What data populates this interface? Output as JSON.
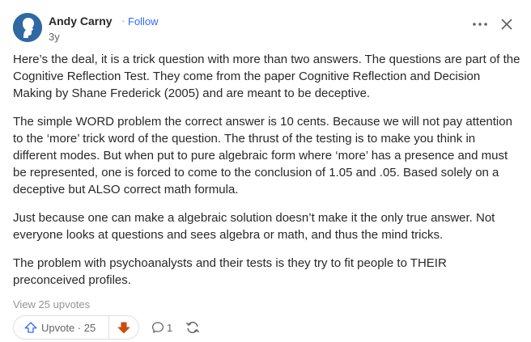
{
  "author": {
    "name": "Andy Carny",
    "separator": "·",
    "follow_label": "Follow",
    "timestamp": "3y"
  },
  "header": {
    "more_icon": "more-horizontal-icon",
    "close_icon": "close-icon"
  },
  "answer": {
    "paragraphs": [
      "Here’s the deal, it is a trick question with more than two answers. The questions are part of the Cognitive Reflection Test. They come from the paper Cognitive Reflection and Decision Making by Shane Frederick (2005) and are meant to be deceptive.",
      "The simple WORD problem the correct answer is 10 cents. Because we will not pay attention to the ‘more’ trick word of the question. The thrust of the testing is to make you think in different modes. But when put to pure algebraic form where ‘more’ has a presence and must be represented, one is forced to come to the conclusion of 1.05 and .05. Based solely on a deceptive but ALSO correct math formula.",
      "Just because one can make a algebraic solution doesn’t make it the only true answer. Not everyone looks at questions and sees algebra or math, and thus the mind tricks.",
      "The problem with psychoanalysts and their tests is they try to fit people to THEIR preconceived profiles."
    ]
  },
  "footer": {
    "upvotes_link": "View 25 upvotes",
    "upvote_label": "Upvote · 25",
    "comment_count": "1"
  },
  "colors": {
    "accent": "#2e69ff",
    "downvote": "#cb4b10",
    "avatar": "#2e69a3"
  }
}
